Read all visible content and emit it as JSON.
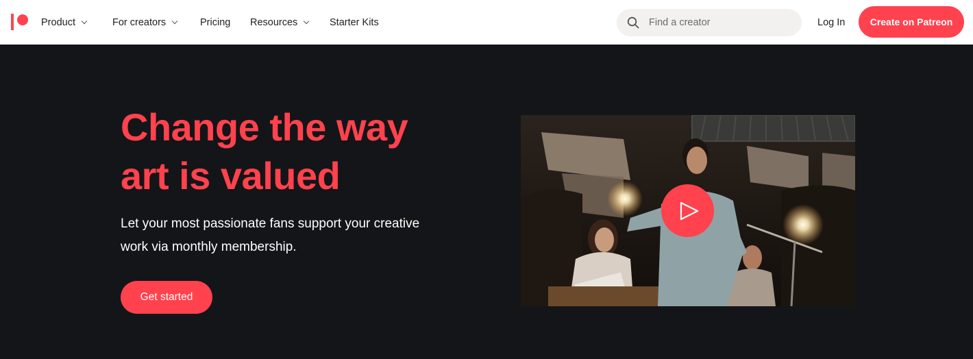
{
  "nav": {
    "items": [
      {
        "label": "Product",
        "has_dropdown": true
      },
      {
        "label": "For creators",
        "has_dropdown": true
      },
      {
        "label": "Pricing",
        "has_dropdown": false
      },
      {
        "label": "Resources",
        "has_dropdown": true
      },
      {
        "label": "Starter Kits",
        "has_dropdown": false
      }
    ],
    "search": {
      "placeholder": "Find a creator",
      "value": "",
      "icon": "search-icon"
    },
    "login_label": "Log In",
    "create_label": "Create on Patreon"
  },
  "hero": {
    "title_line1": "Change the way",
    "title_line2": "art is valued",
    "subtitle_line1": "Let your most passionate fans support your creative",
    "subtitle_line2": "work via monthly membership.",
    "cta_label": "Get started"
  },
  "video": {
    "play_icon": "play-icon"
  },
  "colors": {
    "brand": "#ff424d",
    "hero_bg": "#141518",
    "nav_bg": "#ffffff",
    "search_bg": "#f2f1ef"
  }
}
